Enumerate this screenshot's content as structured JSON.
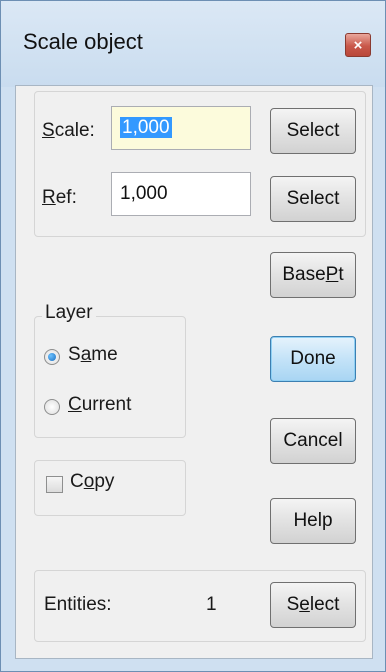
{
  "window": {
    "title": "Scale object",
    "close_icon": "close-icon",
    "accent": "#c9584a"
  },
  "scale": {
    "label_pre": "",
    "label_u": "S",
    "label_post": "cale:",
    "value": "1,000",
    "button": "Select"
  },
  "ref": {
    "label_pre": "",
    "label_u": "R",
    "label_post": "ef:",
    "value": "1,000",
    "button": "Select"
  },
  "base_pt": {
    "pre": "Base ",
    "u": "P",
    "post": "t"
  },
  "layer": {
    "legend": "Layer",
    "same": {
      "pre": "S",
      "u": "a",
      "post": "me",
      "checked": true
    },
    "current": {
      "pre": "",
      "u": "C",
      "post": "urrent",
      "checked": false
    }
  },
  "copy": {
    "pre": "C",
    "u": "o",
    "post": "py",
    "checked": false
  },
  "buttons": {
    "done": "Done",
    "cancel": "Cancel",
    "help": "Help"
  },
  "entities": {
    "label": "Entities:",
    "count": "1",
    "button_pre": "S",
    "button_u": "e",
    "button_post": "lect"
  }
}
